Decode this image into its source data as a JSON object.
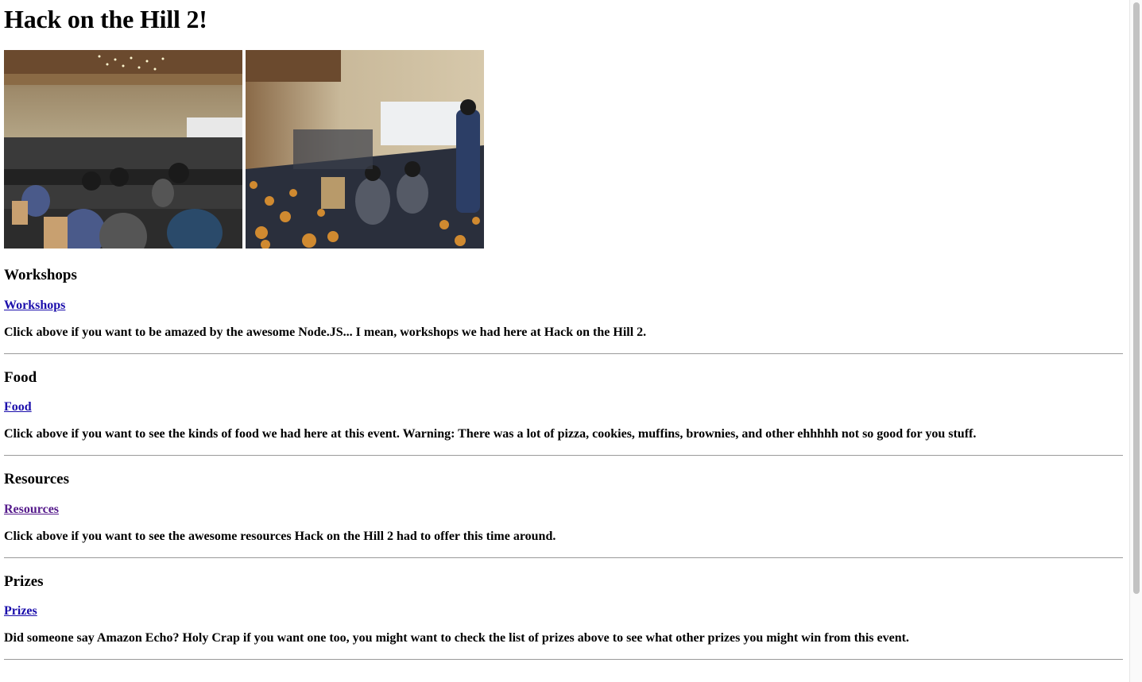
{
  "page": {
    "title": "Hack on the Hill 2!"
  },
  "photos": [
    {
      "name": "hackathon-hall-photo-1"
    },
    {
      "name": "hackathon-hall-photo-2"
    }
  ],
  "sections": [
    {
      "heading": "Workshops",
      "link": "Workshops",
      "description": "Click above if you want to be amazed by the awesome Node.JS... I mean, workshops we had here at Hack on the Hill 2."
    },
    {
      "heading": "Food",
      "link": "Food",
      "description": "Click above if you want to see the kinds of food we had here at this event. Warning: There was a lot of pizza, cookies, muffins, brownies, and other ehhhhh not so good for you stuff."
    },
    {
      "heading": "Resources",
      "link": "Resources",
      "description": "Click above if you want to see the awesome resources Hack on the Hill 2 had to offer this time around."
    },
    {
      "heading": "Prizes",
      "link": "Prizes",
      "description": "Did someone say Amazon Echo? Holy Crap if you want one too, you might want to check the list of prizes above to see what other prizes you might win from this event."
    }
  ],
  "colors": {
    "link": "#1a0dab",
    "visited_link": "#551a8b",
    "rule": "#9a9a9a"
  }
}
